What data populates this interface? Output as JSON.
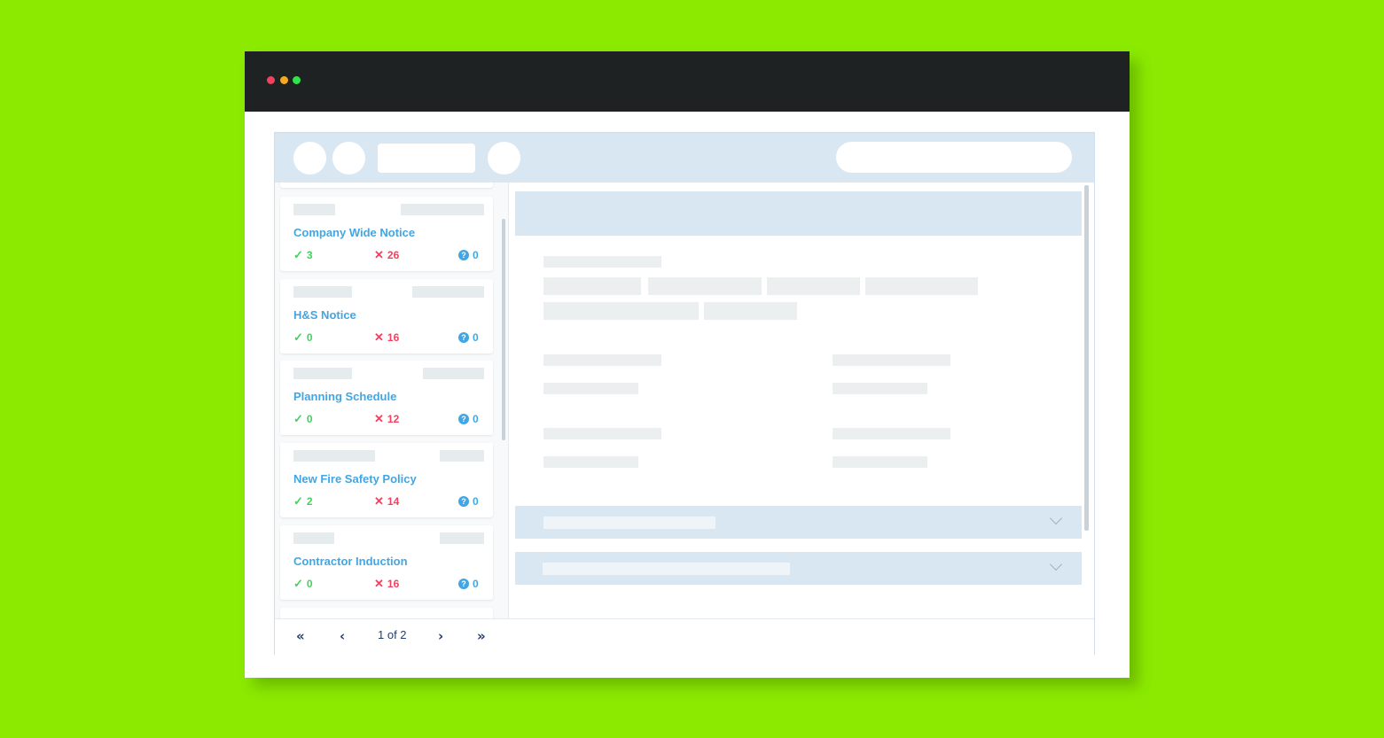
{
  "window": {
    "controls": [
      "close",
      "minimize",
      "maximize"
    ]
  },
  "notices": [
    {
      "title": "Company Wide Notice",
      "accepted": "3",
      "declined": "26",
      "unknown": "0"
    },
    {
      "title": "H&S Notice",
      "accepted": "0",
      "declined": "16",
      "unknown": "0"
    },
    {
      "title": "Planning Schedule",
      "accepted": "0",
      "declined": "12",
      "unknown": "0"
    },
    {
      "title": "New Fire Safety Policy",
      "accepted": "2",
      "declined": "14",
      "unknown": "0"
    },
    {
      "title": "Contractor Induction",
      "accepted": "0",
      "declined": "16",
      "unknown": "0"
    }
  ],
  "icons": {
    "accepted": "check-icon",
    "declined": "cross-icon",
    "unknown": "question-icon"
  },
  "pagination": {
    "label": "1 of 2",
    "first": "«",
    "prev": "‹",
    "next": "›",
    "last": "»"
  },
  "colors": {
    "background": "#8bea00",
    "titlebar": "#1f2222",
    "accent": "#42a6e4",
    "success": "#3fd45a",
    "danger": "#f0425e",
    "panel": "#d9e7f2"
  }
}
